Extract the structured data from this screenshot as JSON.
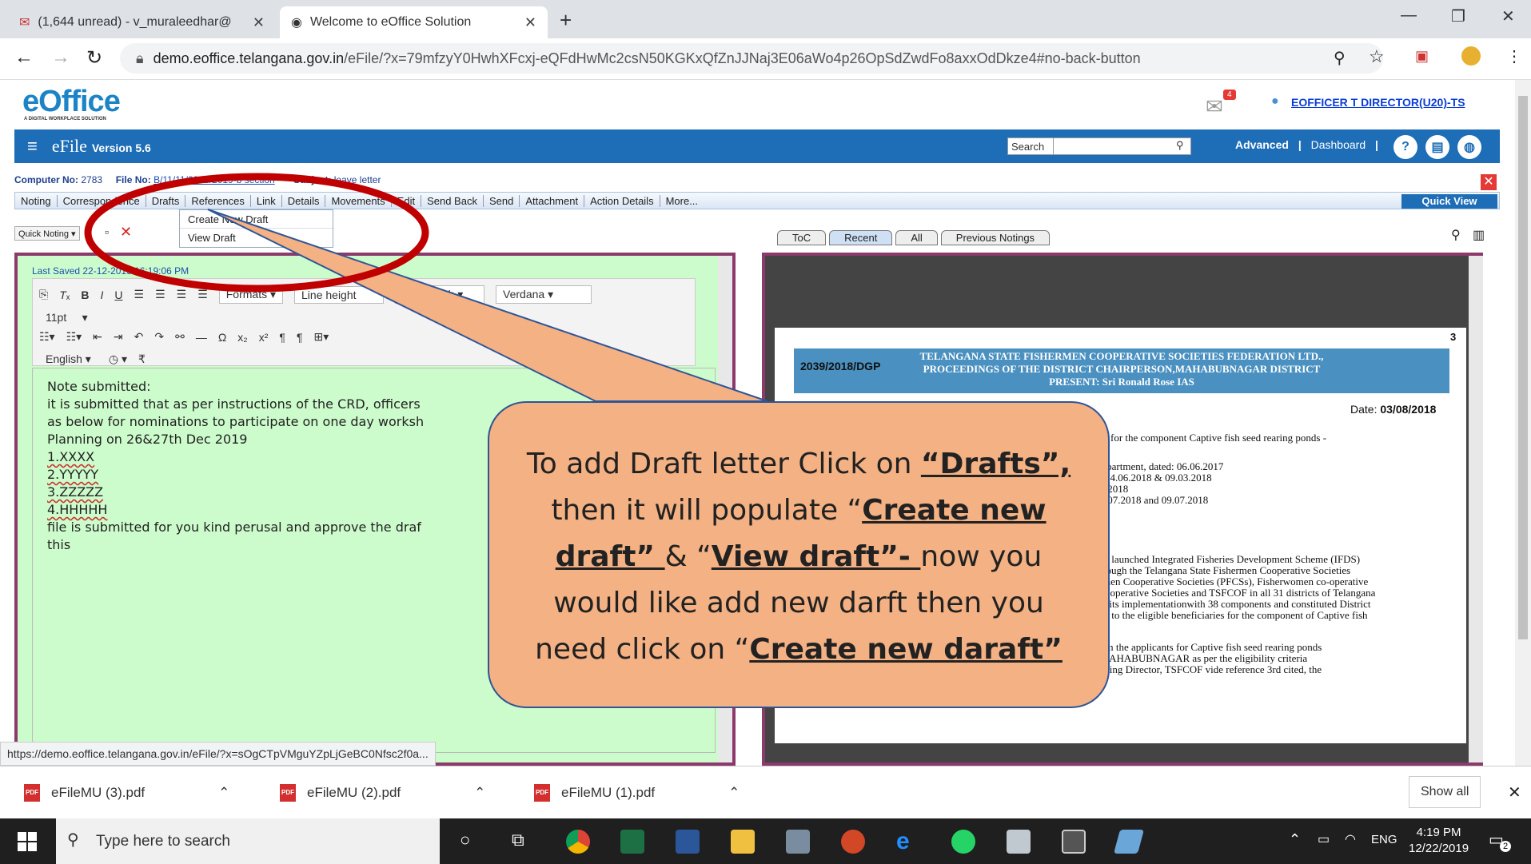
{
  "browser": {
    "tabs": [
      {
        "label": "(1,644 unread) - v_muraleedhar@"
      },
      {
        "label": "Welcome to eOffice Solution"
      }
    ],
    "url_host": "demo.eoffice.telangana.gov.in",
    "url_path": "/eFile/?x=79mfzyY0HwhXFcxj-eQFdHwMc2csN50KGKxQfZnJJNaj3E06aWo4p26OpSdZwdFo8axxOdDkze4#no-back-button",
    "status_url": "https://demo.eoffice.telangana.gov.in/eFile/?x=sOgCTpVMguYZpLjGeBC0Nfsc2f0a..."
  },
  "app": {
    "logo_text": "eOffice",
    "logo_tagline": "A DIGITAL WORKPLACE SOLUTION",
    "notification_count": "4",
    "user": "EOFFICER T  DIRECTOR(U20)-TS",
    "title": "eFile",
    "version": "Version 5.6",
    "search_label": "Search",
    "nav": [
      "Advanced",
      "Dashboard"
    ],
    "computer_no_label": "Computer No:",
    "computer_no": "2783",
    "file_no_label": "File No:",
    "file_no": "B/11/11/0008/2019-b section",
    "subject_label": "Subject:",
    "subject": "leave letter",
    "menu": [
      "Noting",
      "Correspondence",
      "Drafts",
      "References",
      "Link",
      "Details",
      "Movements",
      "Edit",
      "Send Back",
      "Send",
      "Attachment",
      "Action Details",
      "More..."
    ],
    "quick_view": "Quick View",
    "dropdown": [
      "Create New Draft",
      "View Draft"
    ],
    "quick_noting": "Quick Noting",
    "view_tabs": [
      "ToC",
      "Recent",
      "All",
      "Previous Notings"
    ],
    "last_saved": "Last Saved 22-12-2019 16:19:06 PM"
  },
  "editor": {
    "formats": "Formats",
    "line_height": "Line height",
    "paragraph": "Paragraph",
    "font": "Verdana",
    "size": "11pt",
    "language": "English",
    "lines": [
      "Note submitted:",
      "it is submitted that as per instructions of the CRD, officers",
      "as below for nominations to participate on one day worksh",
      "Planning on 26&27th Dec 2019",
      "1.XXXX",
      "2.YYYYY",
      "3.ZZZZZ",
      "4.HHHHH",
      "file is submitted for you kind perusal and approve the draf",
      "this"
    ]
  },
  "document": {
    "page_no": "3",
    "ref": "2039/2018/DGP",
    "banner": [
      "TELANGANA STATE FISHERMEN COOPERATIVE SOCIETIES FEDERATION LTD.,",
      "PROCEEDINGS OF THE DISTRICT CHAIRPERSON,MAHABUBNAGAR  DISTRICT",
      "PRESENT: Sri Ronald Rose IAS"
    ],
    "date_label": "Date:",
    "date": "03/08/2018",
    "snippets": [
      "for the component Captive fish seed rearing ponds -",
      "Department, dated: 06.06.2017",
      "d. 14.06.2018 & 09.03.2018",
      "07.2018",
      "06.07.2018 and 09.07.2018",
      "ana launched Integrated Fisheries Development Scheme (IFDS)",
      "through the Telangana State Fishermen Cooperative Societies",
      "ermen Cooperative Societies (PFCSs), Fisherwomen co-operative",
      "Co-operative Societies and TSFCOF in all 31 districts of Telangana",
      "for its implementationwith 38 components and constituted District",
      "ons to the eligible beneficiaries for the component of Captive fish",
      "Based on the guidelines, the applications have been received from the applicants for Captive fish seed rearing ponds",
      "component and their eligibility has been verified by the District Manager,MAHABUBNAGAR  as per the eligibility criteria",
      "given vide ref. 1st and 2nd cited. Further, as per orders issued by the Managing Director, TSFCOF vide reference 3rd cited, the"
    ]
  },
  "callout": {
    "t1": "To add Draft letter Click on ",
    "b1": "“Drafts”,",
    "t2": " then it will populate “",
    "b2": "Create new draft” ",
    "t3": "& “",
    "b3": "View draft”- ",
    "t4": " now you would like add new darft then you need click on “",
    "b4": "Create new daraft”"
  },
  "downloads": {
    "files": [
      "eFileMU (3).pdf",
      "eFileMU (2).pdf",
      "eFileMU (1).pdf"
    ],
    "show_all": "Show all"
  },
  "taskbar": {
    "search_placeholder": "Type here to search",
    "lang": "ENG",
    "time": "4:19 PM",
    "date": "12/22/2019",
    "notif": "2"
  },
  "colors": {
    "accent": "#1d6db7",
    "panel_border": "#8b3a6b",
    "callout": "#f4b183",
    "highlight_ring": "#c00000"
  }
}
